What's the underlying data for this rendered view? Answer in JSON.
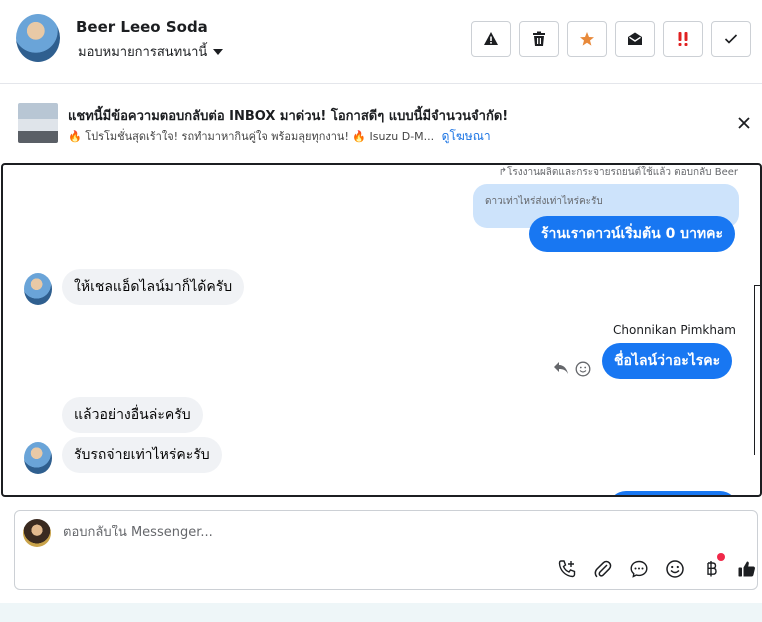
{
  "header": {
    "contact_name": "Beer Leeo Soda",
    "assign_label": "มอบหมายการสนทนานี้",
    "actions": [
      {
        "name": "warning-button",
        "icon": "warning-icon"
      },
      {
        "name": "delete-button",
        "icon": "trash-icon"
      },
      {
        "name": "star-button",
        "icon": "star-icon"
      },
      {
        "name": "mark-unread-button",
        "icon": "envelope-open-icon"
      },
      {
        "name": "priority-button",
        "icon": "double-exclamation-icon"
      },
      {
        "name": "done-button",
        "icon": "check-icon"
      }
    ]
  },
  "promo": {
    "title": "แชทนี้มีข้อความตอบกลับต่อ INBOX มาด่วน! โอกาสดีๆ แบบนี้มีจำนวนจำกัด!",
    "subtitle": "🔥 โปรโมชั่นสุดเร้าใจ! รถทำมาหากินคู่ใจ พร้อมลุยทุกงาน! 🔥 Isuzu D-M...",
    "link": "ดูโฆษณา"
  },
  "chat": {
    "reply_note": "โรงงานผลิตและกระจายรถยนต์ใช้แล้ว ตอบกลับ Beer",
    "quoted_text": "ดาวเท่าไหร่ส่งเท่าไหร่คะรับ",
    "messages": [
      {
        "from": "me",
        "text": "ร้านเราดาวน์เริ่มต้น 0 บาทคะ"
      },
      {
        "from": "them",
        "text": "ให้เชลแอ็ดไลน์มาก็ได้ครับ"
      },
      {
        "from": "me",
        "sender": "Chonnikan Pimkham",
        "text": "ชื่อไลน์ว่าอะไรคะ"
      },
      {
        "from": "them",
        "text": "แล้วอย่างอื่นล่ะครับ"
      },
      {
        "from": "them",
        "text": "รับรถจ่ายเท่าไหร่คะรับ"
      }
    ]
  },
  "composer": {
    "placeholder": "ตอบกลับใน Messenger...",
    "tools": [
      "phone-add-icon",
      "paperclip-icon",
      "chat-bubble-icon",
      "smiley-icon",
      "baht-icon",
      "thumbs-up-icon"
    ]
  },
  "colors": {
    "accent": "#1877f2",
    "star": "#e8893a",
    "priority": "#e02020",
    "notification": "#f02849"
  }
}
